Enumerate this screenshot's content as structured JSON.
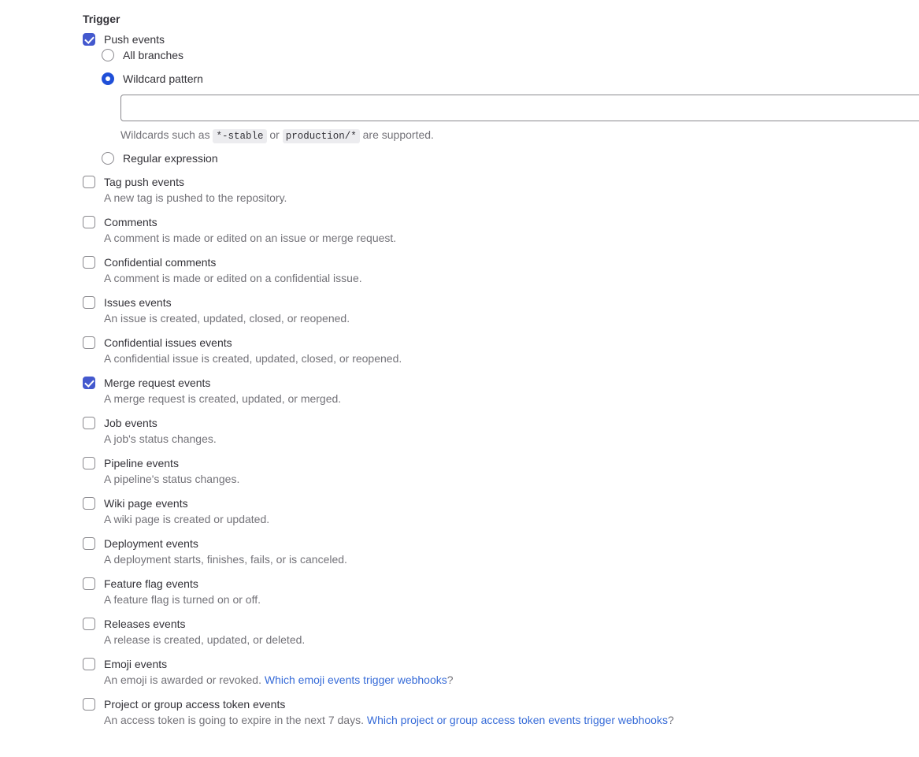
{
  "section": {
    "heading": "Trigger"
  },
  "push": {
    "label": "Push events",
    "checked": true,
    "branch_options": [
      {
        "label": "All branches",
        "selected": false,
        "name": "all-branches"
      },
      {
        "label": "Wildcard pattern",
        "selected": true,
        "name": "wildcard-pattern"
      },
      {
        "label": "Regular expression",
        "selected": false,
        "name": "regular-expression"
      }
    ],
    "wildcard_input": {
      "value": "",
      "placeholder": ""
    },
    "wildcard_help": {
      "prefix": "Wildcards such as ",
      "code_1": "*-stable",
      "middle": " or ",
      "code_2": "production/*",
      "suffix": " are supported."
    }
  },
  "events": [
    {
      "name": "tag-push-events",
      "label": "Tag push events",
      "description": "A new tag is pushed to the repository.",
      "checked": false
    },
    {
      "name": "comments",
      "label": "Comments",
      "description": "A comment is made or edited on an issue or merge request.",
      "checked": false
    },
    {
      "name": "confidential-comments",
      "label": "Confidential comments",
      "description": "A comment is made or edited on a confidential issue.",
      "checked": false
    },
    {
      "name": "issues-events",
      "label": "Issues events",
      "description": "An issue is created, updated, closed, or reopened.",
      "checked": false
    },
    {
      "name": "confidential-issues-events",
      "label": "Confidential issues events",
      "description": "A confidential issue is created, updated, closed, or reopened.",
      "checked": false
    },
    {
      "name": "merge-request-events",
      "label": "Merge request events",
      "description": "A merge request is created, updated, or merged.",
      "checked": true
    },
    {
      "name": "job-events",
      "label": "Job events",
      "description": "A job's status changes.",
      "checked": false
    },
    {
      "name": "pipeline-events",
      "label": "Pipeline events",
      "description": "A pipeline's status changes.",
      "checked": false
    },
    {
      "name": "wiki-page-events",
      "label": "Wiki page events",
      "description": "A wiki page is created or updated.",
      "checked": false
    },
    {
      "name": "deployment-events",
      "label": "Deployment events",
      "description": "A deployment starts, finishes, fails, or is canceled.",
      "checked": false
    },
    {
      "name": "feature-flag-events",
      "label": "Feature flag events",
      "description": "A feature flag is turned on or off.",
      "checked": false
    },
    {
      "name": "releases-events",
      "label": "Releases events",
      "description": "A release is created, updated, or deleted.",
      "checked": false
    },
    {
      "name": "emoji-events",
      "label": "Emoji events",
      "description": "An emoji is awarded or revoked. ",
      "checked": false,
      "link_text": "Which emoji events trigger webhooks",
      "description_suffix": "?"
    },
    {
      "name": "project-or-group-access-token-events",
      "label": "Project or group access token events",
      "description": "An access token is going to expire in the next 7 days. ",
      "checked": false,
      "link_text": "Which project or group access token events trigger webhooks",
      "description_suffix": "?"
    }
  ],
  "colors": {
    "accent_checkbox": "#4459ce",
    "accent_radio": "#1f4fd8",
    "link": "#366bd8",
    "label_text": "#333238",
    "description_text": "#737278",
    "border": "#89888d",
    "chip_background": "#ececef"
  }
}
